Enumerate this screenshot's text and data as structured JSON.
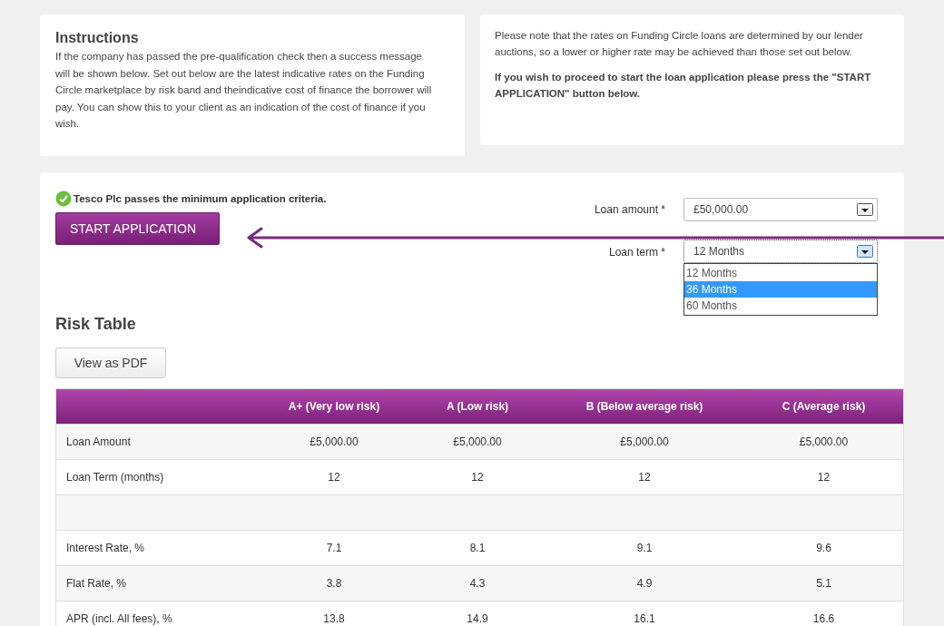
{
  "instructions": {
    "title": "Instructions",
    "text": "If the company has passed the pre-qualification check then a success message will be shown below. Set out below are the latest indicative rates on the Funding Circle marketplace by risk band and theindicative cost of finance the borrower will pay. You can show this to your client as an indication of the cost of finance if you wish."
  },
  "note": {
    "text": "Please note that the rates on Funding Circle loans are determined by our lender auctions, so a lower or higher rate may be achieved than those set out below.",
    "bold_text": "If you wish to proceed to start the loan application please press the \"START APPLICATION\" button below."
  },
  "success_message": "Tesco Plc passes the minimum application criteria.",
  "start_button": "START APPLICATION",
  "loan_amount": {
    "label": "Loan amount *",
    "value": "£50,000.00"
  },
  "loan_term": {
    "label": "Loan term *",
    "value": "12 Months",
    "expanded": true,
    "options": [
      {
        "label": "12 Months",
        "highlighted": false
      },
      {
        "label": "36 Months",
        "highlighted": true
      },
      {
        "label": "60 Months",
        "highlighted": false
      }
    ]
  },
  "risk_table": {
    "title": "Risk Table",
    "pdf_button": "View as PDF",
    "columns": [
      "A+ (Very low risk)",
      "A (Low risk)",
      "B (Below average risk)",
      "C (Average risk)"
    ],
    "rows": [
      {
        "label": "Loan Amount",
        "cells": [
          "£5,000.00",
          "£5,000.00",
          "£5,000.00",
          "£5,000.00"
        ]
      },
      {
        "label": "Loan Term (months)",
        "cells": [
          "12",
          "12",
          "12",
          "12"
        ]
      },
      {
        "kind": "spacer"
      },
      {
        "label": "Interest Rate, %",
        "cells": [
          "7.1",
          "8.1",
          "9.1",
          "9.6"
        ]
      },
      {
        "label": "Flat Rate, %",
        "cells": [
          "3.8",
          "4.3",
          "4.9",
          "5.1"
        ]
      },
      {
        "label": "APR (incl. All fees), %",
        "cells": [
          "13.8",
          "14.9",
          "16.1",
          "16.6"
        ]
      }
    ]
  }
}
